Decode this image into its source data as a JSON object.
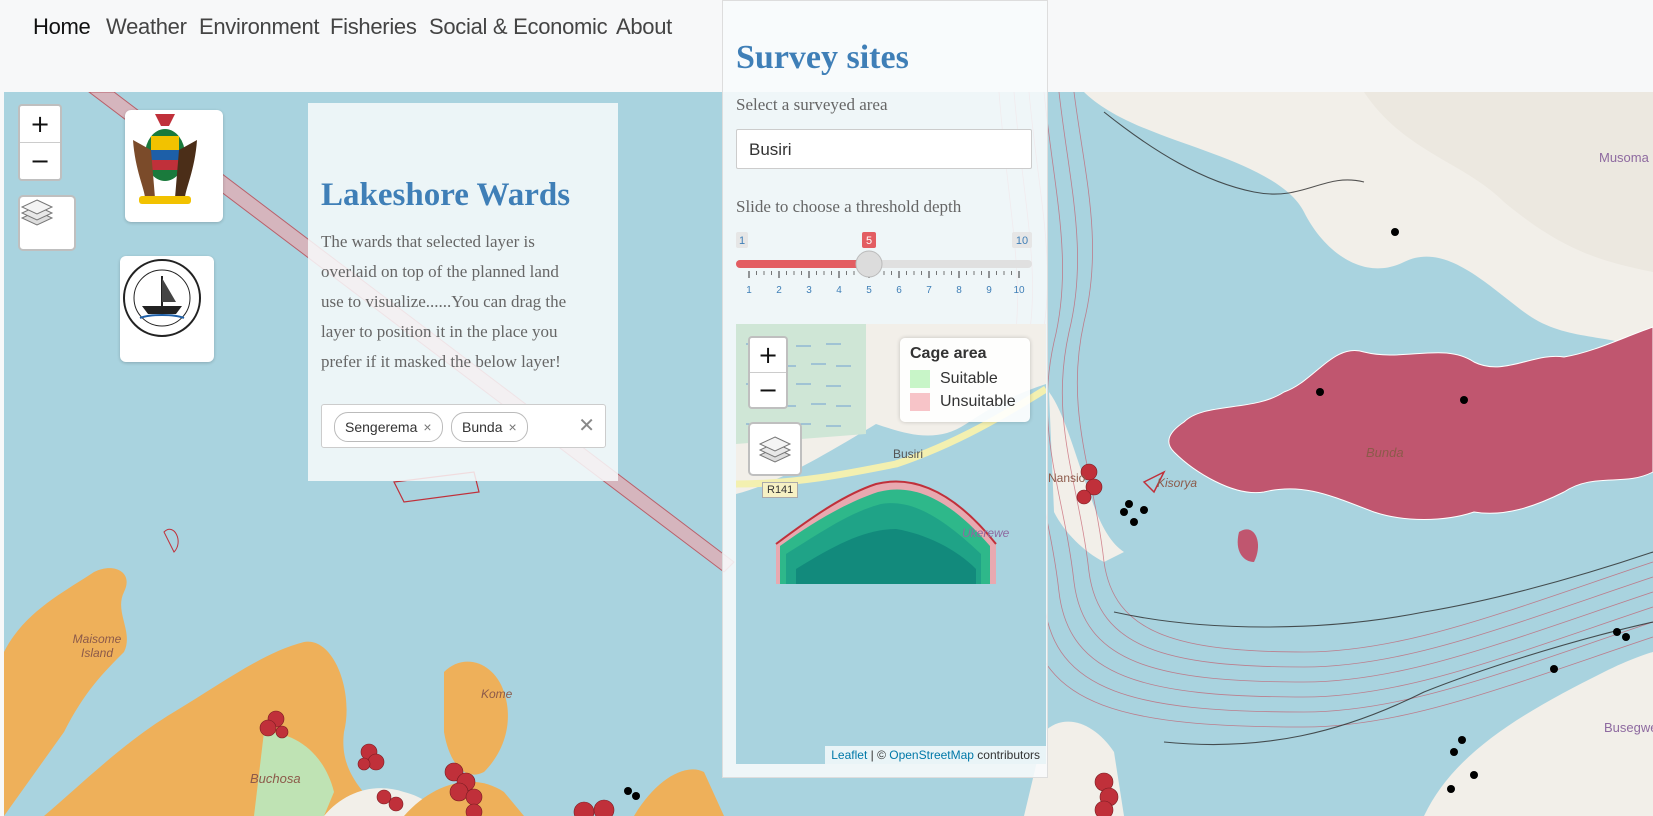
{
  "nav": {
    "items": [
      {
        "label": "Home",
        "active": true
      },
      {
        "label": "Weather"
      },
      {
        "label": "Environment"
      },
      {
        "label": "Fisheries"
      },
      {
        "label": "Social & Economic"
      },
      {
        "label": "About"
      }
    ]
  },
  "main_map": {
    "zoom_in": "+",
    "zoom_out": "−",
    "layers_icon": "layers-icon",
    "place_labels": {
      "maisome": "Maisome Island",
      "kome": "Kome",
      "buchosa": "Buchosa",
      "bunda": "Bunda",
      "kisorya": "Kisorya",
      "musoma": "Musoma",
      "busegwe": "Busegwe",
      "nansio": "Nansio"
    }
  },
  "wards_panel": {
    "title": "Lakeshore Wards",
    "description": "The wards that selected layer is overlaid on top of the planned land use to visualize......You can drag the layer to position it in the place you prefer if it masked the below layer!",
    "selected": [
      "Sengerema",
      "Bunda"
    ],
    "remove_glyph": "×",
    "clear_glyph": "✕"
  },
  "survey_panel": {
    "title": "Survey sites",
    "area_label": "Select a surveyed area",
    "area_value": "Busiri",
    "threshold_label": "Slide to choose a threshold depth",
    "slider": {
      "min": 1,
      "max": 10,
      "value": 5,
      "ticks": [
        "1",
        "2",
        "3",
        "4",
        "5",
        "6",
        "7",
        "8",
        "9",
        "10"
      ]
    },
    "minimap": {
      "zoom_in": "+",
      "zoom_out": "−",
      "place": "Busiri",
      "road": "R141",
      "ukerewe": "Ukerewe",
      "legend": {
        "title": "Cage area",
        "items": [
          {
            "label": "Suitable",
            "color": "#c8f5c8"
          },
          {
            "label": "Unsuitable",
            "color": "#f7c4c8"
          }
        ]
      },
      "attribution": {
        "leaflet": "Leaflet",
        "sep": " | © ",
        "osm": "OpenStreetMap",
        "rest": " contributors"
      }
    }
  },
  "colors": {
    "accent": "#3f7fb7",
    "water": "#a9d3df",
    "land": "#f2efe9",
    "ward": "#c0566f",
    "district": "#eeb05a",
    "slider": "#e35d62"
  }
}
